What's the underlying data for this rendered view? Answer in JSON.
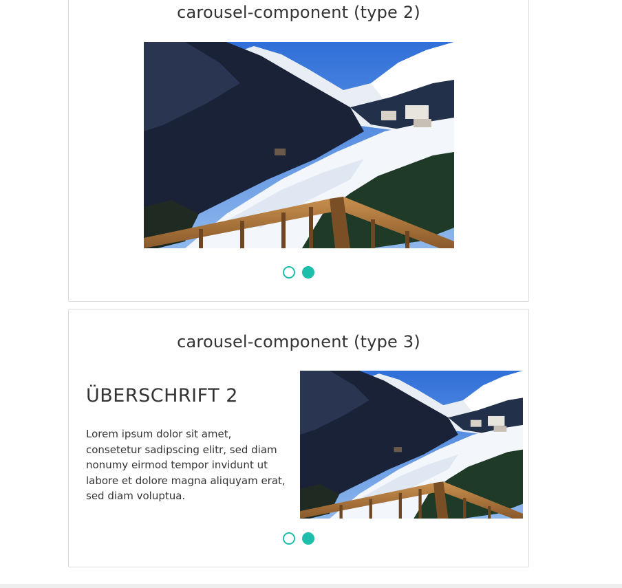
{
  "carousel_type2": {
    "title": "carousel-component (type 2)",
    "slide_count": 2,
    "active_slide": 2
  },
  "carousel_type3": {
    "title": "carousel-component (type 3)",
    "heading": "ÜBERSCHRIFT 2",
    "body": "Lorem ipsum dolor sit amet, consetetur sadipscing elitr, sed diam nonumy eirmod tempor invidunt ut labore et dolore magna aliquyam erat, sed diam voluptua.",
    "slide_count": 2,
    "active_slide": 2
  },
  "colors": {
    "accent": "#1ebfaa",
    "border": "#dcdcdc",
    "text": "#333333"
  }
}
